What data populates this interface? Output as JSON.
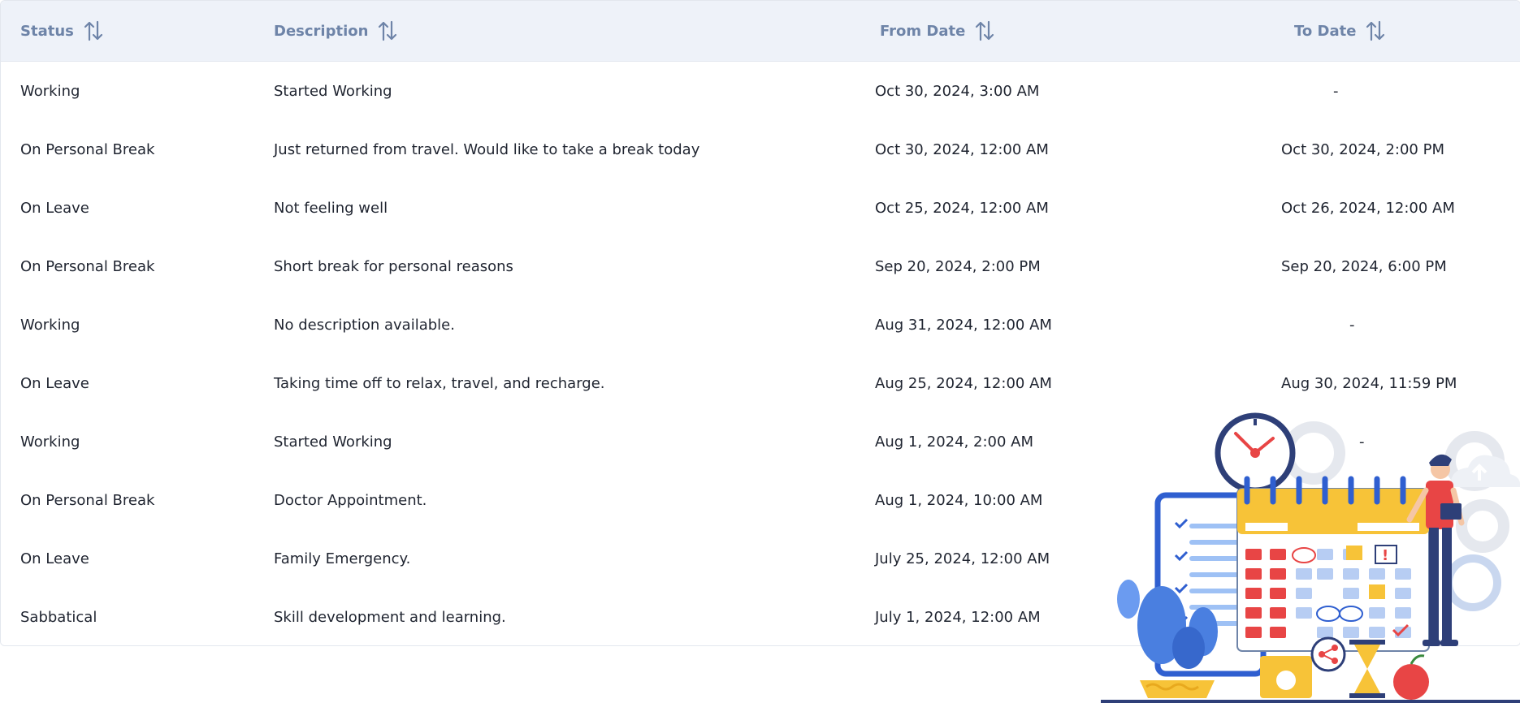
{
  "table": {
    "columns": [
      {
        "label": "Status"
      },
      {
        "label": "Description"
      },
      {
        "label": "From Date"
      },
      {
        "label": "To Date"
      }
    ],
    "rows": [
      {
        "status": "Working",
        "description": "Started Working",
        "from": "Oct 30, 2024, 3:00 AM",
        "to": "-"
      },
      {
        "status": "On Personal Break",
        "description": "Just returned from travel. Would like to take a break today",
        "from": "Oct 30, 2024, 12:00 AM",
        "to": "Oct 30, 2024, 2:00 PM"
      },
      {
        "status": "On Leave",
        "description": "Not feeling well",
        "from": "Oct 25, 2024, 12:00 AM",
        "to": "Oct 26, 2024, 12:00 AM"
      },
      {
        "status": "On Personal Break",
        "description": "Short break for personal reasons",
        "from": "Sep 20, 2024, 2:00 PM",
        "to": "Sep 20, 2024, 6:00 PM"
      },
      {
        "status": "Working",
        "description": "No description available.",
        "from": "Aug 31, 2024, 12:00 AM",
        "to": "-"
      },
      {
        "status": "On Leave",
        "description": "Taking time off to relax, travel, and recharge.",
        "from": "Aug 25, 2024, 12:00 AM",
        "to": "Aug 30, 2024, 11:59 PM"
      },
      {
        "status": "Working",
        "description": "Started Working",
        "from": "Aug 1, 2024, 2:00 AM",
        "to": "-"
      },
      {
        "status": "On Personal Break",
        "description": "Doctor Appointment.",
        "from": "Aug 1, 2024, 10:00 AM",
        "to": ""
      },
      {
        "status": "On Leave",
        "description": "Family Emergency.",
        "from": "July 25, 2024, 12:00 AM",
        "to": ""
      },
      {
        "status": "Sabbatical",
        "description": "Skill development and learning.",
        "from": "July 1, 2024, 12:00 AM",
        "to": ""
      }
    ]
  },
  "icons": {
    "sort": "sort-arrows-icon",
    "illustration": "calendar-schedule-illustration"
  },
  "colors": {
    "header_bg": "#eef2f9",
    "header_text": "#6e84a8",
    "row_border": "#e8ebf0",
    "illustration_blue": "#3b6fd8",
    "illustration_red": "#e84545",
    "illustration_yellow": "#f7c338"
  }
}
